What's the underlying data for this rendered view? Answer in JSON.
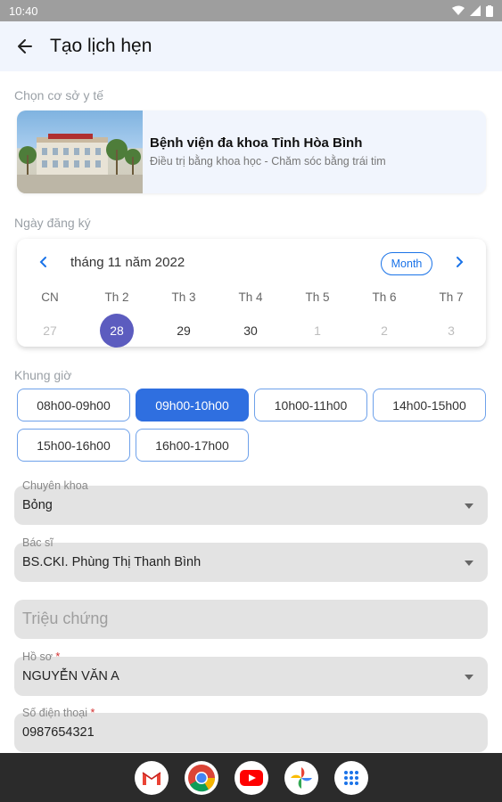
{
  "status": {
    "time": "10:40"
  },
  "appbar": {
    "title": "Tạo lịch hẹn"
  },
  "facility_section": {
    "label": "Chọn cơ sở y tế",
    "name": "Bệnh viện đa khoa Tỉnh Hòa Bình",
    "tagline": "Điều trị bằng khoa học - Chăm sóc bằng trái tim"
  },
  "date_section": {
    "label": "Ngày đăng ký",
    "calendar": {
      "title": "tháng 11 năm 2022",
      "view_button": "Month",
      "days": [
        {
          "weekday": "CN",
          "day": "27",
          "state": "muted"
        },
        {
          "weekday": "Th 2",
          "day": "28",
          "state": "selected"
        },
        {
          "weekday": "Th 3",
          "day": "29",
          "state": "normal"
        },
        {
          "weekday": "Th 4",
          "day": "30",
          "state": "normal"
        },
        {
          "weekday": "Th 5",
          "day": "1",
          "state": "muted"
        },
        {
          "weekday": "Th 6",
          "day": "2",
          "state": "muted"
        },
        {
          "weekday": "Th 7",
          "day": "3",
          "state": "muted"
        }
      ]
    }
  },
  "time_section": {
    "label": "Khung giờ",
    "slots": [
      {
        "label": "08h00-09h00",
        "selected": false
      },
      {
        "label": "09h00-10h00",
        "selected": true
      },
      {
        "label": "10h00-11h00",
        "selected": false
      },
      {
        "label": "14h00-15h00",
        "selected": false
      },
      {
        "label": "15h00-16h00",
        "selected": false
      },
      {
        "label": "16h00-17h00",
        "selected": false
      }
    ]
  },
  "form": {
    "specialty": {
      "label": "Chuyên khoa",
      "value": "Bỏng"
    },
    "doctor": {
      "label": "Bác sĩ",
      "value": "BS.CKI. Phùng Thị Thanh Bình"
    },
    "symptoms": {
      "placeholder": "Triệu chứng"
    },
    "profile": {
      "label": "Hồ sơ",
      "required_mark": "*",
      "value": "NGUYỄN VĂN A"
    },
    "phone": {
      "label": "Số điện thoại",
      "required_mark": "*",
      "value": "0987654321"
    }
  },
  "dock": {
    "apps": [
      "gmail-icon",
      "chrome-icon",
      "youtube-icon",
      "photos-icon",
      "app-drawer-icon"
    ]
  },
  "colors": {
    "accent": "#2f6fe0",
    "selected_day": "#5c5cbf",
    "appbar_bg": "#f1f5fd",
    "field_bg": "#e3e3e3"
  }
}
